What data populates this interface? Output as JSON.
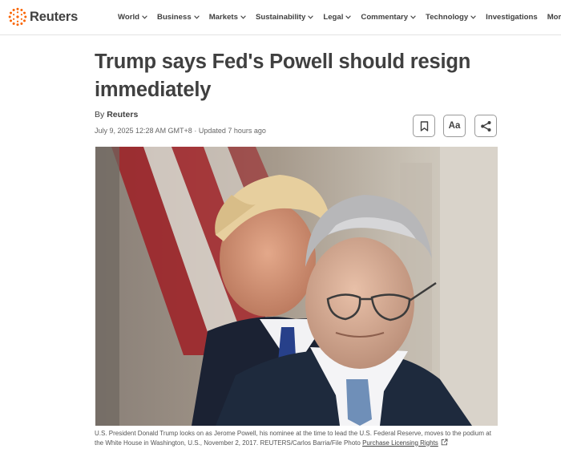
{
  "header": {
    "logo_text": "Reuters",
    "nav": [
      {
        "label": "World",
        "has_menu": true
      },
      {
        "label": "Business",
        "has_menu": true
      },
      {
        "label": "Markets",
        "has_menu": true
      },
      {
        "label": "Sustainability",
        "has_menu": true
      },
      {
        "label": "Legal",
        "has_menu": true
      },
      {
        "label": "Commentary",
        "has_menu": true
      },
      {
        "label": "Technology",
        "has_menu": true
      },
      {
        "label": "Investigations",
        "has_menu": false
      },
      {
        "label": "More",
        "has_menu": true
      }
    ]
  },
  "article": {
    "headline": "Trump says Fed's Powell should resign immediately",
    "byline_prefix": "By",
    "byline_author": "Reuters",
    "dateline": "July 9, 2025 12:28 AM GMT+8 · Updated 7 hours ago",
    "tools": {
      "bookmark_icon": "bookmark-icon",
      "text_size_label": "Aa",
      "share_icon": "share-icon"
    },
    "photo": {
      "description_icon": "photo"
    },
    "caption": "U.S. President Donald Trump looks on as Jerome Powell, his nominee at the time to lead the U.S. Federal Reserve, moves to the podium at the White House in Washington, U.S., November 2, 2017. REUTERS/Carlos Barria/File Photo",
    "license_link": "Purchase Licensing Rights"
  },
  "colors": {
    "text": "#404040",
    "brand_orange": "#fa6400",
    "border": "#e4e4e4"
  }
}
